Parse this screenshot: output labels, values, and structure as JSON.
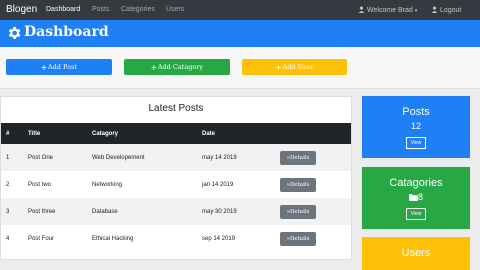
{
  "navbar": {
    "brand": "Blogen",
    "links": [
      "Dashboard",
      "Posts",
      "Categories",
      "Users"
    ],
    "welcome": "Welcome Brad",
    "logout": "Logout"
  },
  "header": {
    "title": "Dashboard"
  },
  "actions": {
    "add_post": "Add Post",
    "add_category": "Add Catagory",
    "add_user": "Add User"
  },
  "latest_posts": {
    "title": "Latest Posts",
    "columns": [
      "#",
      "Title",
      "Catagory",
      "Date"
    ],
    "rows": [
      {
        "num": "1",
        "title": "Post One",
        "category": "Web Developement",
        "date": "may 14 2019",
        "action": "Details"
      },
      {
        "num": "2",
        "title": "Post two",
        "category": "Networking",
        "date": "jan 14 2019",
        "action": "Details"
      },
      {
        "num": "3",
        "title": "Post three",
        "category": "Database",
        "date": "may 30 2019",
        "action": "Details"
      },
      {
        "num": "4",
        "title": "Post Four",
        "category": "Ethical Hacking",
        "date": "sep 14 2019",
        "action": "Details"
      }
    ]
  },
  "stats": {
    "posts": {
      "title": "Posts",
      "value": "12",
      "view": "View"
    },
    "categories": {
      "title": "Catagories",
      "value": "8",
      "view": "View"
    },
    "users": {
      "title": "Users"
    }
  },
  "colors": {
    "navbar": "#343a40",
    "header": "#1f7ff5",
    "primary": "#1f7ff5",
    "success": "#28a745",
    "warning": "#ffc107",
    "secondary": "#6c757d",
    "table_head": "#212529"
  }
}
